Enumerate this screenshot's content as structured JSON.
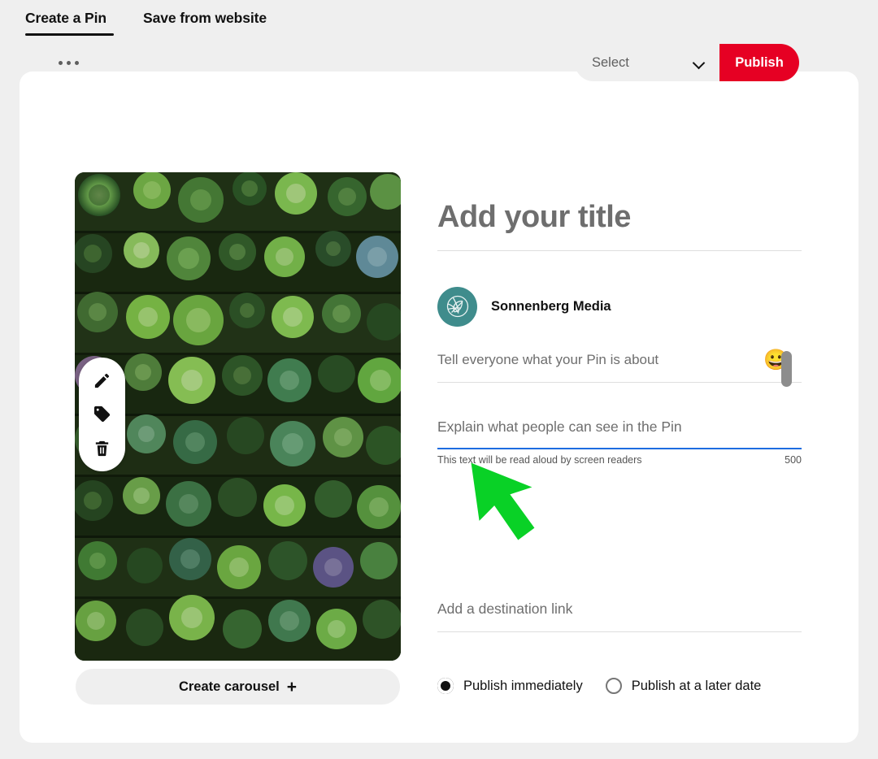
{
  "tabs": [
    {
      "label": "Create a Pin",
      "active": true
    },
    {
      "label": "Save from website",
      "active": false
    }
  ],
  "toolbar": {
    "overflow_icon": "kebab-menu-icon",
    "select_value": "Select",
    "select_chevron_icon": "chevron-down-icon",
    "publish_label": "Publish",
    "publish_color": "#e60023"
  },
  "media": {
    "alt": "Wall of assorted green succulent rosettes",
    "tools": [
      {
        "name": "edit-pencil-icon",
        "label": "Edit"
      },
      {
        "name": "tag-icon",
        "label": "Tag products"
      },
      {
        "name": "trash-icon",
        "label": "Delete"
      }
    ],
    "carousel_label": "Create carousel",
    "carousel_plus": "+"
  },
  "form": {
    "title_placeholder": "Add your title",
    "account_name": "Sonnenberg Media",
    "avatar_icon": "leaf-globe-logo-icon",
    "avatar_color": "#3f8c8c",
    "description_placeholder": "Tell everyone what your Pin is about",
    "emoji_icon": "😀",
    "alt_text_placeholder": "Explain what people can see in the Pin",
    "alt_text_helper": "This text will be read aloud by screen readers",
    "alt_text_counter": "500",
    "alt_text_focus_color": "#1d6ce0",
    "link_placeholder": "Add a destination link",
    "schedule_options": [
      {
        "label": "Publish immediately",
        "selected": true
      },
      {
        "label": "Publish at a later date",
        "selected": false
      }
    ]
  },
  "annotation": {
    "cursor_color": "#09d126",
    "cursor_icon": "arrow-cursor-annotation"
  }
}
